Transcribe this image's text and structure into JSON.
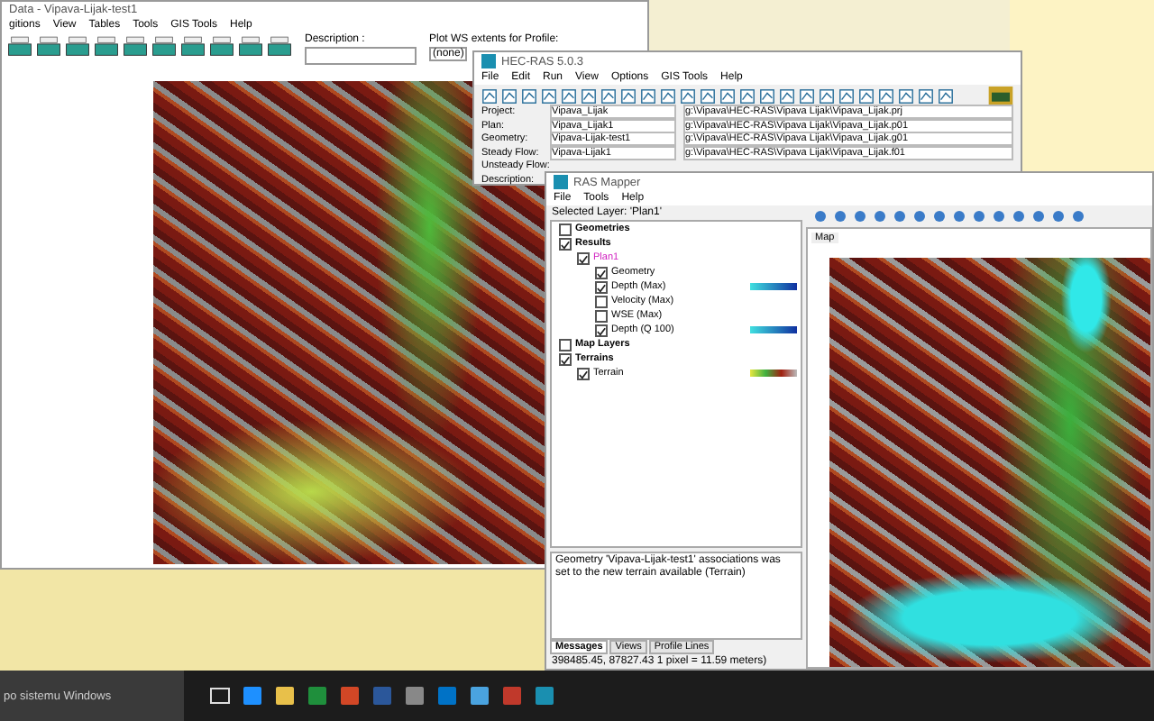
{
  "geometry_editor": {
    "title": "Data - Vipava-Lijak-test1",
    "menu": [
      "gitions",
      "View",
      "Tables",
      "Tools",
      "GIS Tools",
      "Help"
    ],
    "description_label": "Description :",
    "plot_label": "Plot WS extents for Profile:",
    "plot_value": "(none)"
  },
  "hecras": {
    "title": "HEC-RAS 5.0.3",
    "menu": [
      "File",
      "Edit",
      "Run",
      "View",
      "Options",
      "GIS Tools",
      "Help"
    ],
    "rows": [
      {
        "label": "Project:",
        "value": "Vipava_Lijak",
        "path": "g:\\Vipava\\HEC-RAS\\Vipava Lijak\\Vipava_Lijak.prj"
      },
      {
        "label": "Plan:",
        "value": "Vipava_Lijak1",
        "path": "g:\\Vipava\\HEC-RAS\\Vipava Lijak\\Vipava_Lijak.p01"
      },
      {
        "label": "Geometry:",
        "value": "Vipava-Lijak-test1",
        "path": "g:\\Vipava\\HEC-RAS\\Vipava Lijak\\Vipava_Lijak.g01"
      },
      {
        "label": "Steady Flow:",
        "value": "Vipava-Lijak1",
        "path": "g:\\Vipava\\HEC-RAS\\Vipava Lijak\\Vipava_Lijak.f01"
      },
      {
        "label": "Unsteady Flow:"
      },
      {
        "label": "Description:"
      }
    ]
  },
  "ras_mapper": {
    "title": "RAS Mapper",
    "menu": [
      "File",
      "Tools",
      "Help"
    ],
    "selected_layer": "Selected Layer: 'Plan1'",
    "tree": [
      {
        "label": "Geometries",
        "checked": false,
        "kind": "group"
      },
      {
        "label": "Results",
        "checked": true,
        "kind": "group",
        "children": [
          {
            "label": "Plan1",
            "checked": true,
            "kind": "plan",
            "active": true,
            "children": [
              {
                "label": "Geometry",
                "checked": true,
                "kind": "layer"
              },
              {
                "label": "Depth (Max)",
                "checked": true,
                "kind": "depth"
              },
              {
                "label": "Velocity (Max)",
                "checked": false,
                "kind": "layer"
              },
              {
                "label": "WSE (Max)",
                "checked": false,
                "kind": "layer"
              },
              {
                "label": "Depth (Q 100)",
                "checked": true,
                "kind": "depth"
              }
            ]
          }
        ]
      },
      {
        "label": "Map Layers",
        "checked": false,
        "kind": "group"
      },
      {
        "label": "Terrains",
        "checked": true,
        "kind": "group",
        "children": [
          {
            "label": "Terrain",
            "checked": true,
            "kind": "terrain"
          }
        ]
      }
    ],
    "map_tab": "Map",
    "message": "Geometry 'Vipava-Lijak-test1' associations was set to the new terrain available (Terrain)",
    "tabs": [
      {
        "label": "Messages",
        "selected": true
      },
      {
        "label": "Views",
        "selected": false
      },
      {
        "label": "Profile Lines",
        "selected": false
      }
    ],
    "status": "398485.45, 87827.43   1 pixel = 11.59 meters)"
  },
  "taskbar": {
    "search_placeholder": "po sistemu Windows"
  }
}
